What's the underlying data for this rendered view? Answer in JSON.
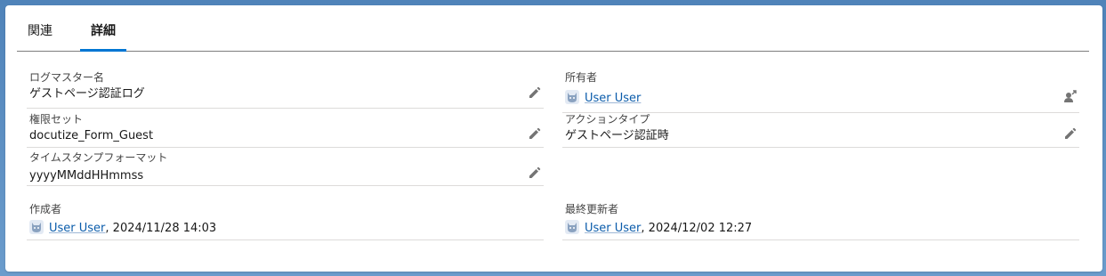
{
  "tabs": [
    {
      "label": "関連"
    },
    {
      "label": "詳細"
    }
  ],
  "fields": {
    "log_master_name": {
      "label": "ログマスター名",
      "value": "ゲストページ認証ログ"
    },
    "owner": {
      "label": "所有者",
      "value": "User User"
    },
    "permission_set": {
      "label": "権限セット",
      "value": "docutize_Form_Guest"
    },
    "action_type": {
      "label": "アクションタイプ",
      "value": "ゲストページ認証時"
    },
    "timestamp_format": {
      "label": "タイムスタンプフォーマット",
      "value": "yyyyMMddHHmmss"
    },
    "created_by": {
      "label": "作成者",
      "user": "User User",
      "datetime": ", 2024/11/28 14:03"
    },
    "last_modified_by": {
      "label": "最終更新者",
      "user": "User User",
      "datetime": ", 2024/12/02 12:27"
    }
  },
  "icons": {
    "edit": "pencil-icon",
    "owner_change": "change-owner-icon",
    "avatar": "user-avatar-icon"
  },
  "colors": {
    "accent": "#0176d3",
    "link": "#0b5cab",
    "background": "#5b8dc0"
  }
}
